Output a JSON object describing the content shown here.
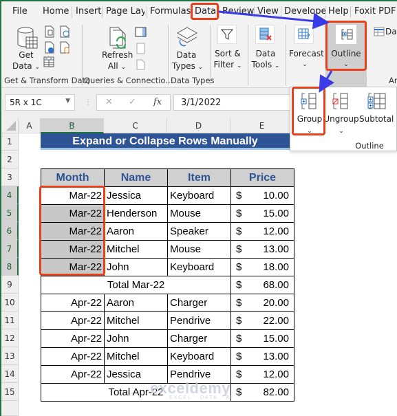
{
  "ribbon_tabs": [
    "File",
    "Home",
    "Insert",
    "Page Layo",
    "Formulas",
    "Data",
    "Review",
    "View",
    "Develope",
    "Help",
    "Foxit PDF"
  ],
  "active_tab": "Data",
  "ribbon": {
    "get_transform": {
      "get_data": "Get",
      "get_data2": "Data",
      "group_label": "Get & Transform Data"
    },
    "queries": {
      "refresh": "Refresh",
      "refresh2": "All",
      "group_label": "Queries & Connectio..."
    },
    "data_types": {
      "label1": "Data",
      "label2": "Types",
      "group_label": "Data Types"
    },
    "sort_filter": {
      "label1": "Sort &",
      "label2": "Filter"
    },
    "data_tools": {
      "label1": "Data",
      "label2": "Tools"
    },
    "forecast": {
      "label1": "Forecast"
    },
    "outline": {
      "label1": "Outline"
    },
    "analyze": {
      "partial_label": "Dat",
      "group_partial": "An"
    }
  },
  "outline_menu": {
    "group": "Group",
    "ungroup": "Ungroup",
    "subtotal": "Subtotal",
    "group_label": "Outline"
  },
  "formula_bar": {
    "name_box": "5R x 1C",
    "cancel": "✕",
    "enter": "✓",
    "fx": "fx",
    "value": "3/1/2022"
  },
  "columns": [
    "A",
    "B",
    "C",
    "D",
    "E"
  ],
  "rows": [
    "1",
    "2",
    "3",
    "4",
    "5",
    "6",
    "7",
    "8",
    "9",
    "10",
    "11",
    "12",
    "13",
    "14",
    "15",
    ""
  ],
  "sheet": {
    "title": "Expand or Collapse Rows Manually",
    "headers": [
      "Month",
      "Name",
      "Item",
      "Price"
    ],
    "data": [
      {
        "month": "Mar-22",
        "name": "Jessica",
        "item": "Keyboard",
        "cur": "$",
        "price": "10.00"
      },
      {
        "month": "Mar-22",
        "name": "Henderson",
        "item": "Mouse",
        "cur": "$",
        "price": "15.00"
      },
      {
        "month": "Mar-22",
        "name": "Aaron",
        "item": "Speaker",
        "cur": "$",
        "price": "12.00"
      },
      {
        "month": "Mar-22",
        "name": "Mitchel",
        "item": "Mouse",
        "cur": "$",
        "price": "13.00"
      },
      {
        "month": "Mar-22",
        "name": "John",
        "item": "Keyboard",
        "cur": "$",
        "price": "18.00"
      }
    ],
    "total1": {
      "label": "Total Mar-22",
      "cur": "$",
      "price": "68.00"
    },
    "data2": [
      {
        "month": "Apr-22",
        "name": "Aaron",
        "item": "Charger",
        "cur": "$",
        "price": "20.00"
      },
      {
        "month": "Apr-22",
        "name": "Mitchel",
        "item": "Pendrive",
        "cur": "$",
        "price": "22.00"
      },
      {
        "month": "Apr-22",
        "name": "John",
        "item": "Charger",
        "cur": "$",
        "price": "15.00"
      },
      {
        "month": "Apr-22",
        "name": "Mitchel",
        "item": "Keyboard",
        "cur": "$",
        "price": "13.00"
      },
      {
        "month": "Apr-22",
        "name": "Jessica",
        "item": "Pendrive",
        "cur": "$",
        "price": "12.00"
      }
    ],
    "total2": {
      "label": "Total Apr-22",
      "cur": "$",
      "price": "82.00"
    }
  },
  "watermark": {
    "brand": "exceldemy",
    "tagline": "EXCEL · DATA · BI"
  },
  "colors": {
    "accent_red": "#e8401c",
    "arrow_blue": "#3a3ae6",
    "title_blue": "#2e5496",
    "excel_green": "#217346"
  }
}
